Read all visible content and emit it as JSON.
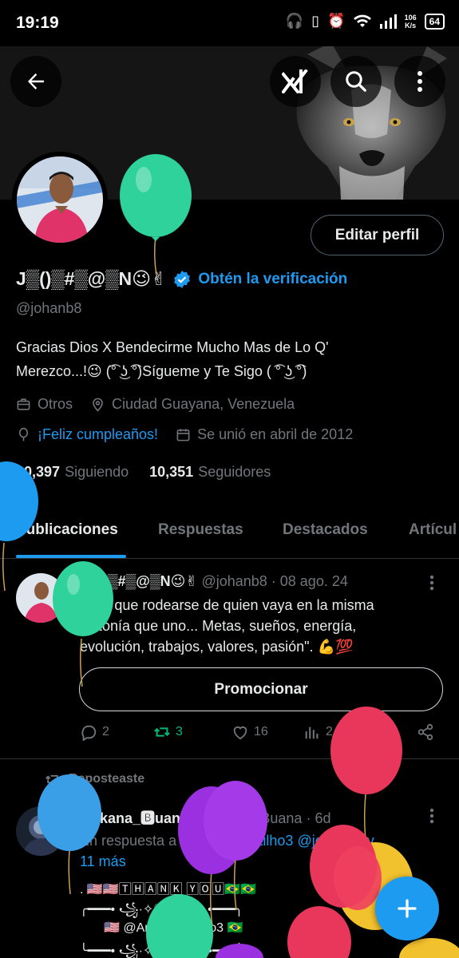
{
  "status_bar": {
    "time": "19:19",
    "speed_value": "106",
    "speed_unit": "K/s",
    "battery": "64"
  },
  "profile": {
    "display_name": "J▒()▒#▒@▒N😉✌",
    "get_verified_label": "Obtén la verificación",
    "handle": "@johanb8",
    "edit_profile_label": "Editar perfil",
    "bio_line1": "Gracias Dios X Bendecirme Mucho Mas de Lo Q'",
    "bio_line2": "Merezco...!😉 (͡° ͜ʖ ͡°)Sígueme y Te Sigo ( ͡° ͜ʖ ͡°)",
    "category": "Otros",
    "location": "Ciudad Guayana, Venezuela",
    "birthday": "¡Feliz cumpleaños!",
    "joined": "Se unió en abril de 2012",
    "following_count": "10,397",
    "following_label": "Siguiendo",
    "followers_count": "10,351",
    "followers_label": "Seguidores"
  },
  "tabs": [
    {
      "label": "Publicaciones",
      "active": true
    },
    {
      "label": "Respuestas",
      "active": false
    },
    {
      "label": "Destacados",
      "active": false
    },
    {
      "label": "Artícul",
      "active": false
    }
  ],
  "post1": {
    "author_name": "J▒()▒#▒@▒N😉✌",
    "handle_date": "@johanb8 · 08 ago. 24",
    "text_line1": "\"Hay que rodearse de quien vaya en la misma",
    "text_line2": "sintonía que uno... Metas, sueños, energía,",
    "text_line3": "evolución, trabajos, valores, pasión\". 💪💯",
    "promote_label": "Promocionar",
    "replies": "2",
    "reposts": "3",
    "likes": "16",
    "views": "2.3K"
  },
  "post2": {
    "reposted_label": "Reposteaste",
    "author_name": "🅰rkana_🅱uana",
    "handle_date": "@Arkana_Buana · 6d",
    "reply_prefix": "En respuesta a",
    "reply_mentions": "@AndraCastilho3 @johanb8 y",
    "reply_more": "11 más",
    "line1": ". 🇺🇸🇺🇸🅃🄷🄰🄽🄺 🅈🄾🅄🇧🇷🇧🇷",
    "line2": "╭━━━• ꧁·✧♡·✧·꧂ •━━━╮",
    "line3": "🇺🇸 @AndraCastilho3 🇧🇷",
    "line4": "╰━━━• ꧁·✧♡·✧·꧂ •━━━╯"
  },
  "colors": {
    "background": "#000000",
    "accent": "#1d9bf0",
    "repost_green": "#00ba7c",
    "muted": "#71767b"
  }
}
